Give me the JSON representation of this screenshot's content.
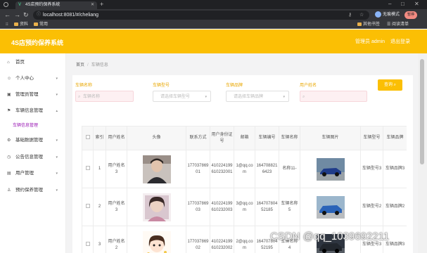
{
  "browser": {
    "tab_title": "4S店预约保养系统",
    "new_tab": "+",
    "url": "localhost:8081/#/cheliang",
    "profile": "无痕模式",
    "paused": "暂停",
    "window_controls": [
      "–",
      "□",
      "✕"
    ],
    "bookmarks": [
      "资料",
      "常用"
    ],
    "bookmarks_right": [
      "其他书签",
      "阅读清单"
    ]
  },
  "header": {
    "title": "4S店预约保养系统",
    "admin": "管理员 admin",
    "logout": "退出登录"
  },
  "sidebar": {
    "items": [
      {
        "label": "首页",
        "icon": "home-icon",
        "glyph": "⌂"
      },
      {
        "label": "个人中心",
        "icon": "user-icon",
        "glyph": "☺"
      },
      {
        "label": "管理员管理",
        "icon": "admin-icon",
        "glyph": "▣"
      },
      {
        "label": "车辆信息管理",
        "icon": "flag-icon",
        "glyph": "⚑"
      },
      {
        "label": "基础数据管理",
        "icon": "gear-icon",
        "glyph": "⚙"
      },
      {
        "label": "公告信息管理",
        "icon": "clock-icon",
        "glyph": "◷"
      },
      {
        "label": "用户管理",
        "icon": "users-icon",
        "glyph": "▤"
      },
      {
        "label": "预约保养管理",
        "icon": "calendar-icon",
        "glyph": "♙"
      }
    ],
    "sub_item": "车辆信息管理"
  },
  "breadcrumb": {
    "home": "首页",
    "separator": "/",
    "current": "车辆信息"
  },
  "filters": {
    "car_name": {
      "label": "车辆名称",
      "placeholder": "车辆名称"
    },
    "car_model": {
      "label": "车辆型号",
      "placeholder": "请选择车辆型号"
    },
    "car_brand": {
      "label": "车辆品牌",
      "placeholder": "请选择车辆品牌"
    },
    "user_name": {
      "label": "用户姓名",
      "placeholder": ""
    },
    "search_label": "查询"
  },
  "table": {
    "headers": [
      "",
      "索引",
      "用户姓名",
      "头像",
      "联系方式",
      "用户身份证号",
      "邮箱",
      "车辆编号",
      "车辆名称",
      "车辆图片",
      "车辆型号",
      "车辆品牌"
    ],
    "rows": [
      {
        "index": "1",
        "user": "用户姓名3",
        "phone": "17703786901",
        "id_card": "410224199610232001",
        "email": "1@qq.com",
        "car_no": "1647088216423",
        "car_name": "名称11-",
        "model": "车辆型号3",
        "brand": "车辆品牌3"
      },
      {
        "index": "2",
        "user": "用户姓名3",
        "phone": "17703786903",
        "id_card": "410224199610232003",
        "email": "3@qq.com",
        "car_no": "16470780452185",
        "car_name": "车辆名称5",
        "model": "车辆型号2",
        "brand": "车辆品牌2"
      },
      {
        "index": "3",
        "user": "用户姓名2",
        "phone": "17703786902",
        "id_card": "410224199610232002",
        "email": "2@qq.com",
        "car_no": "16470780452195",
        "car_name": "车辆名称4",
        "model": "车辆型号3",
        "brand": "车辆品牌3"
      }
    ]
  },
  "watermark": "CSDN @qq_1039692211",
  "colors": {
    "brand": "#fbbf04",
    "filter_label": "#e9a700",
    "submenu_active": "#9b1bb5"
  }
}
